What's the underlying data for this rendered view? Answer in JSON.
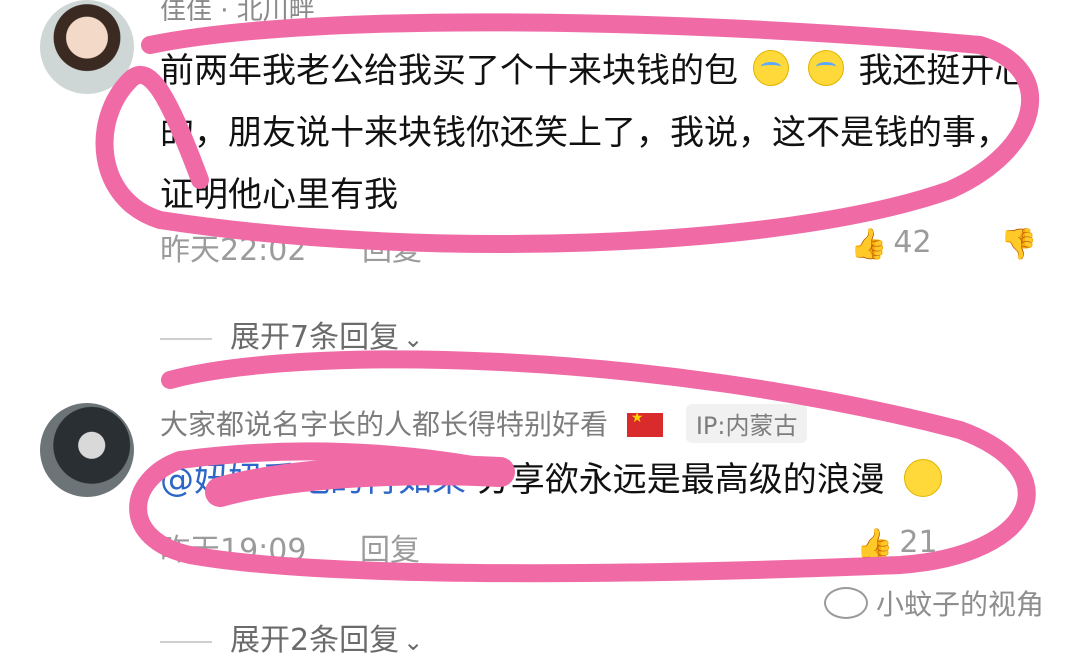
{
  "comments": [
    {
      "author": "佳佳 · 北川畔",
      "text_before_emoji": "前两年我老公给我买了个十来块钱的包",
      "text_after_emoji": "我还挺开心的，朋友说十来块钱你还笑上了，我说，这不是钱的事，证明他心里有我",
      "time": "昨天22:02",
      "reply_label": "回复",
      "likes": "42",
      "expand_label": "展开7条回复"
    },
    {
      "author": "大家都说名字长的人都长得特别好看",
      "ip_label": "IP:内蒙古",
      "mention": "@妞妞爱吃的肖如果",
      "text": "分享欲永远是最高级的浪漫",
      "time": "昨天19:09",
      "reply_label": "回复",
      "likes": "21",
      "expand_label": "展开2条回复"
    }
  ],
  "watermark": "小蚊子的视角",
  "colors": {
    "marker": "#f06aa6",
    "mention": "#2c66c7"
  }
}
